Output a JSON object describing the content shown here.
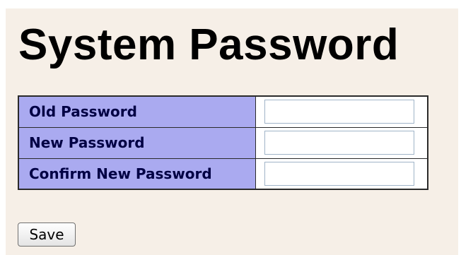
{
  "page": {
    "title": "System Password"
  },
  "form": {
    "rows": [
      {
        "label": "Old Password",
        "value": ""
      },
      {
        "label": "New Password",
        "value": ""
      },
      {
        "label": "Confirm New Password",
        "value": ""
      }
    ],
    "save_label": "Save"
  },
  "colors": {
    "page_background": "#f6efe7",
    "label_background": "#aaaaf0",
    "label_text": "#000044",
    "table_border": "#2a2a2a"
  }
}
